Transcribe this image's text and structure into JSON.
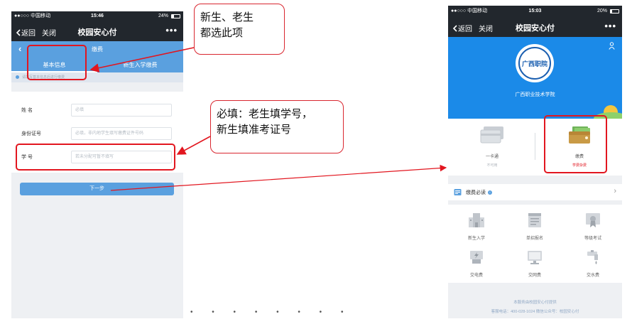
{
  "left_phone": {
    "status": {
      "carrier": "●●○○○ 中国移动",
      "time": "15:46",
      "battery": "24%",
      "battery_level": 0.24
    },
    "nav": {
      "back": "返回",
      "close": "关闭",
      "title": "校园安心付",
      "more": "•••"
    },
    "page_title": "缴费",
    "tabs": [
      {
        "label": "基本信息",
        "active": true
      },
      {
        "label": "新生入学缴费",
        "active": false
      }
    ],
    "notice": "请填写基本信息后进行缴费",
    "form": [
      {
        "label": "姓  名",
        "placeholder": "必填"
      },
      {
        "label": "身份证号",
        "placeholder": "必填，非内地学生填写缴费证件号码"
      },
      {
        "label": "学  号",
        "placeholder": "若未分配可暂不填写"
      }
    ],
    "next_button": "下一步"
  },
  "right_phone": {
    "status": {
      "carrier": "●●○○○ 中国移动",
      "time": "15:03",
      "battery": "20%",
      "battery_level": 0.2
    },
    "nav": {
      "back": "返回",
      "close": "关闭",
      "title": "校园安心付",
      "more": "•••"
    },
    "school_name": "广西职业技术学院",
    "logo_text": "广西职院",
    "cards": [
      {
        "name": "一卡通",
        "status": "不可用",
        "status_color": "#b0b6bd"
      },
      {
        "name": "缴费",
        "status": "学费杂费",
        "status_color": "#e2161f"
      }
    ],
    "must_read": {
      "label": "缴费必读",
      "badge": "i"
    },
    "grid": [
      {
        "label": "新生入学",
        "icon": "building-icon"
      },
      {
        "label": "单招报名",
        "icon": "form-icon"
      },
      {
        "label": "等级考试",
        "icon": "certificate-icon"
      },
      {
        "label": "交电费",
        "icon": "power-icon"
      },
      {
        "label": "交网费",
        "icon": "monitor-icon"
      },
      {
        "label": "交水费",
        "icon": "faucet-icon"
      }
    ],
    "footer": {
      "line1": "本服务由校园安心付提供",
      "line2": "客服电话：400-028-1024  微信公众号：校园安心付"
    }
  },
  "annotations": {
    "callout1_line1": "新生、老生",
    "callout1_line2": "都选此项",
    "callout2_line1": "必填：老生填学号，",
    "callout2_line2": "新生填准考证号",
    "color": "#e2161f"
  },
  "page_dots": "• • • • • • • •"
}
